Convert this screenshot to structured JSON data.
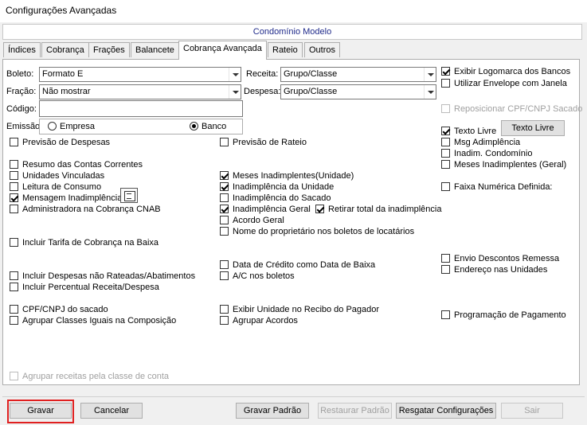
{
  "window_title": "Configurações Avançadas",
  "header_title": "Condomínio Modelo",
  "tabs": [
    "Índices",
    "Cobrança",
    "Frações",
    "Balancete",
    "Cobrança Avançada",
    "Rateio",
    "Outros"
  ],
  "form": {
    "boleto_label": "Boleto:",
    "boleto_value": "Formato E",
    "receita_label": "Receita:",
    "receita_value": "Grupo/Classe",
    "fracao_label": "Fração:",
    "fracao_value": "Não mostrar",
    "despesa_label": "Despesa:",
    "despesa_value": "Grupo/Classe",
    "codigo_label": "Código:",
    "codigo_value": "",
    "emissao_label": "Emissão:",
    "empresa_label": "Empresa",
    "banco_label": "Banco",
    "emissao_selected": "Banco"
  },
  "checks": {
    "exibir_logomarca": "Exibir Logomarca dos Bancos",
    "utilizar_envelope": "Utilizar Envelope com Janela",
    "reposicionar_cpf": "Reposicionar CPF/CNPJ Sacado",
    "texto_livre": "Texto Livre",
    "msg_adimplencia": "Msg Adimplência",
    "inadim_condominio": "Inadim. Condomínio",
    "meses_inadimplentes_geral": "Meses Inadimplentes (Geral)",
    "faixa_numerica": "Faixa Numérica Definida:",
    "previsao_despesas": "Previsão de Despesas",
    "previsao_rateio": "Previsão de Rateio",
    "resumo_contas": "Resumo das Contas Correntes",
    "unidades_vinculadas": "Unidades Vinculadas",
    "leitura_consumo": "Leitura de Consumo",
    "mensagem_inadimplencia": "Mensagem Inadimplência",
    "administradora_cnab": "Administradora na Cobrança CNAB",
    "meses_inadimplentes_unidade": "Meses Inadimplentes(Unidade)",
    "inadimplencia_unidade": "Inadimplência da Unidade",
    "inadimplencia_sacado": "Inadimplência do Sacado",
    "inadimplencia_geral": "Inadimplência Geral",
    "retirar_total": "Retirar total da inadimplência",
    "acordo_geral": "Acordo Geral",
    "nome_proprietario": "Nome do proprietário nos boletos de locatários",
    "incluir_tarifa": "Incluir Tarifa de Cobrança na Baixa",
    "data_credito": "Data de Crédito como Data de Baixa",
    "ac_boletos": "A/C nos boletos",
    "envio_descontos": "Envio Descontos Remessa",
    "endereco_unidades": "Endereço nas Unidades",
    "incluir_despesas": "Incluir Despesas não Rateadas/Abatimentos",
    "incluir_percentual": "Incluir Percentual Receita/Despesa",
    "cpf_sacado": "CPF/CNPJ do sacado",
    "agrupar_classes": "Agrupar Classes Iguais na Composição",
    "exibir_unidade_recibo": "Exibir Unidade no Recibo do Pagador",
    "agrupar_acordos": "Agrupar Acordos",
    "programacao_pagamento": "Programação de Pagamento",
    "agrupar_receitas": "Agrupar receitas pela classe de conta"
  },
  "buttons": {
    "texto_livre": "Texto Livre",
    "gravar": "Gravar",
    "cancelar": "Cancelar",
    "gravar_padrao": "Gravar Padrão",
    "restaurar_padrao": "Restaurar Padrão",
    "resgatar": "Resgatar Configurações",
    "sair": "Sair"
  },
  "colors": {
    "header_text": "#1f2a8a",
    "highlight_border": "#e02020"
  }
}
